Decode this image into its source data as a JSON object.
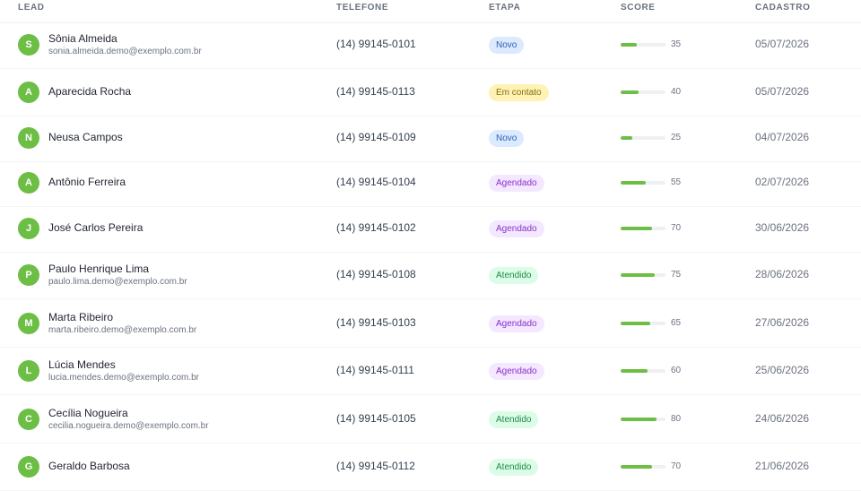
{
  "columns": {
    "lead": "LEAD",
    "telefone": "TELEFONE",
    "etapa": "ETAPA",
    "score": "SCORE",
    "cadastro": "CADASTRO"
  },
  "stage_colors": {
    "Novo": "#dbeafe",
    "Em contato": "#fef3b5",
    "Agendado": "#f3e8ff",
    "Atendido": "#dcfce7"
  },
  "avatar_color": "#6cbe45",
  "leads": [
    {
      "initial": "S",
      "name": "Sônia Almeida",
      "email": "sonia.almeida.demo@exemplo.com.br",
      "phone": "(14) 99145-0101",
      "stage": "Novo",
      "stage_key": "novo",
      "score": 35,
      "date": "05/07/2026"
    },
    {
      "initial": "A",
      "name": "Aparecida Rocha",
      "email": "",
      "phone": "(14) 99145-0113",
      "stage": "Em contato",
      "stage_key": "contato",
      "score": 40,
      "date": "05/07/2026"
    },
    {
      "initial": "N",
      "name": "Neusa Campos",
      "email": "",
      "phone": "(14) 99145-0109",
      "stage": "Novo",
      "stage_key": "novo",
      "score": 25,
      "date": "04/07/2026"
    },
    {
      "initial": "A",
      "name": "Antônio Ferreira",
      "email": "",
      "phone": "(14) 99145-0104",
      "stage": "Agendado",
      "stage_key": "agendado",
      "score": 55,
      "date": "02/07/2026"
    },
    {
      "initial": "J",
      "name": "José Carlos Pereira",
      "email": "",
      "phone": "(14) 99145-0102",
      "stage": "Agendado",
      "stage_key": "agendado",
      "score": 70,
      "date": "30/06/2026"
    },
    {
      "initial": "P",
      "name": "Paulo Henrique Lima",
      "email": "paulo.lima.demo@exemplo.com.br",
      "phone": "(14) 99145-0108",
      "stage": "Atendido",
      "stage_key": "atendido",
      "score": 75,
      "date": "28/06/2026"
    },
    {
      "initial": "M",
      "name": "Marta Ribeiro",
      "email": "marta.ribeiro.demo@exemplo.com.br",
      "phone": "(14) 99145-0103",
      "stage": "Agendado",
      "stage_key": "agendado",
      "score": 65,
      "date": "27/06/2026"
    },
    {
      "initial": "L",
      "name": "Lúcia Mendes",
      "email": "lucia.mendes.demo@exemplo.com.br",
      "phone": "(14) 99145-0111",
      "stage": "Agendado",
      "stage_key": "agendado",
      "score": 60,
      "date": "25/06/2026"
    },
    {
      "initial": "C",
      "name": "Cecília Nogueira",
      "email": "cecilia.nogueira.demo@exemplo.com.br",
      "phone": "(14) 99145-0105",
      "stage": "Atendido",
      "stage_key": "atendido",
      "score": 80,
      "date": "24/06/2026"
    },
    {
      "initial": "G",
      "name": "Geraldo Barbosa",
      "email": "",
      "phone": "(14) 99145-0112",
      "stage": "Atendido",
      "stage_key": "atendido",
      "score": 70,
      "date": "21/06/2026"
    }
  ]
}
